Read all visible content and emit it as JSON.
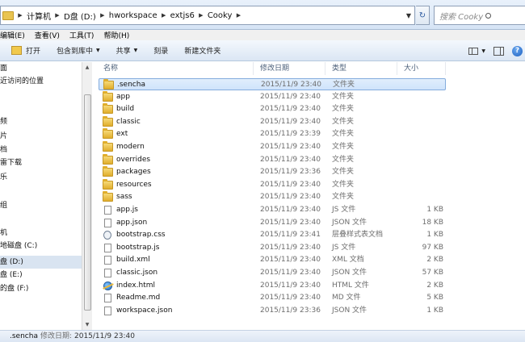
{
  "address": {
    "crumbs": [
      "计算机",
      "D盘 (D:)",
      "hworkspace",
      "extjs6",
      "Cooky"
    ]
  },
  "search": {
    "placeholder": "搜索 Cooky"
  },
  "menu": [
    "编辑(E)",
    "查看(V)",
    "工具(T)",
    "帮助(H)"
  ],
  "toolbar": {
    "open": "打开",
    "include_in_library": "包含到库中",
    "share": "共享",
    "burn": "刻录",
    "new_folder": "新建文件夹"
  },
  "nav": [
    "面",
    "近访问的位置",
    "频",
    "片",
    "档",
    "雷下载",
    "乐",
    "组",
    "机",
    "地磁盘 (C:)",
    "盘 (D:)",
    "盘 (E:)",
    "的盘 (F:)"
  ],
  "columns": {
    "name": "名称",
    "date": "修改日期",
    "type": "类型",
    "size": "大小"
  },
  "files": [
    {
      "name": ".sencha",
      "date": "2015/11/9 23:40",
      "type": "文件夹",
      "size": "",
      "icon": "folder"
    },
    {
      "name": "app",
      "date": "2015/11/9 23:40",
      "type": "文件夹",
      "size": "",
      "icon": "folder"
    },
    {
      "name": "build",
      "date": "2015/11/9 23:40",
      "type": "文件夹",
      "size": "",
      "icon": "folder"
    },
    {
      "name": "classic",
      "date": "2015/11/9 23:40",
      "type": "文件夹",
      "size": "",
      "icon": "folder"
    },
    {
      "name": "ext",
      "date": "2015/11/9 23:39",
      "type": "文件夹",
      "size": "",
      "icon": "folder"
    },
    {
      "name": "modern",
      "date": "2015/11/9 23:40",
      "type": "文件夹",
      "size": "",
      "icon": "folder"
    },
    {
      "name": "overrides",
      "date": "2015/11/9 23:40",
      "type": "文件夹",
      "size": "",
      "icon": "folder"
    },
    {
      "name": "packages",
      "date": "2015/11/9 23:36",
      "type": "文件夹",
      "size": "",
      "icon": "folder"
    },
    {
      "name": "resources",
      "date": "2015/11/9 23:40",
      "type": "文件夹",
      "size": "",
      "icon": "folder"
    },
    {
      "name": "sass",
      "date": "2015/11/9 23:40",
      "type": "文件夹",
      "size": "",
      "icon": "folder"
    },
    {
      "name": "app.js",
      "date": "2015/11/9 23:40",
      "type": "JS 文件",
      "size": "1 KB",
      "icon": "file"
    },
    {
      "name": "app.json",
      "date": "2015/11/9 23:40",
      "type": "JSON 文件",
      "size": "18 KB",
      "icon": "file"
    },
    {
      "name": "bootstrap.css",
      "date": "2015/11/9 23:41",
      "type": "层叠样式表文档",
      "size": "1 KB",
      "icon": "css"
    },
    {
      "name": "bootstrap.js",
      "date": "2015/11/9 23:40",
      "type": "JS 文件",
      "size": "97 KB",
      "icon": "file"
    },
    {
      "name": "build.xml",
      "date": "2015/11/9 23:40",
      "type": "XML 文档",
      "size": "2 KB",
      "icon": "file"
    },
    {
      "name": "classic.json",
      "date": "2015/11/9 23:40",
      "type": "JSON 文件",
      "size": "57 KB",
      "icon": "file"
    },
    {
      "name": "index.html",
      "date": "2015/11/9 23:40",
      "type": "HTML 文件",
      "size": "2 KB",
      "icon": "html"
    },
    {
      "name": "Readme.md",
      "date": "2015/11/9 23:40",
      "type": "MD 文件",
      "size": "5 KB",
      "icon": "file"
    },
    {
      "name": "workspace.json",
      "date": "2015/11/9 23:36",
      "type": "JSON 文件",
      "size": "1 KB",
      "icon": "file"
    }
  ],
  "status": {
    "name": ".sencha",
    "label": "修改日期:",
    "date": "2015/11/9 23:40"
  }
}
